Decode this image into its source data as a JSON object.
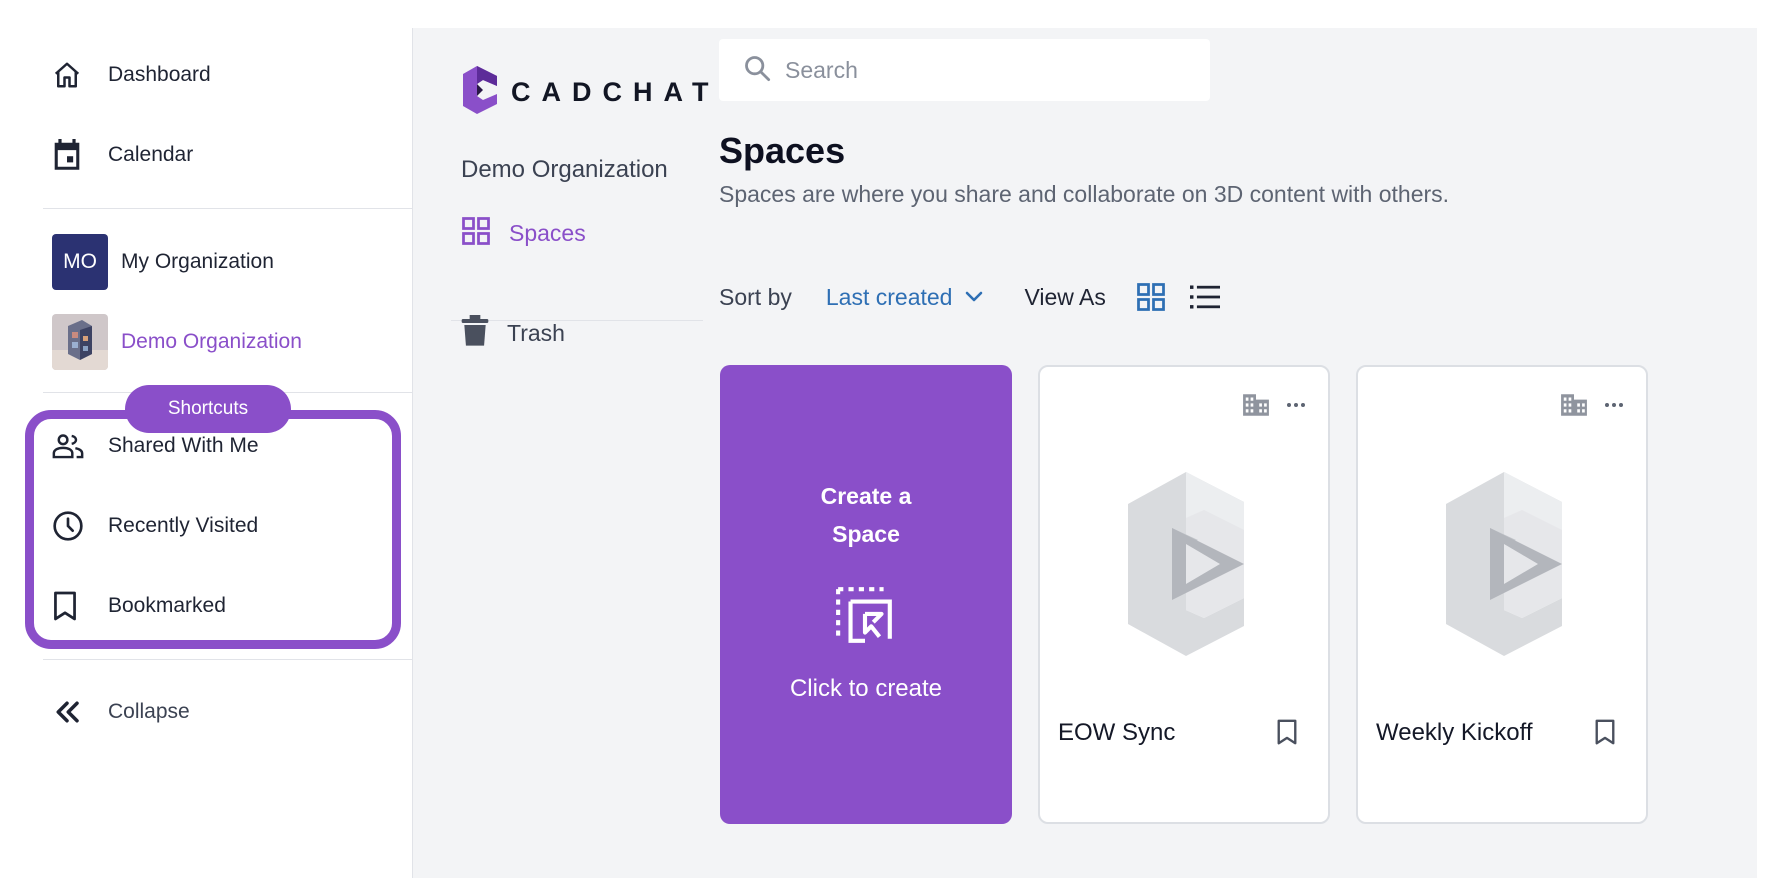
{
  "sidebar": {
    "dashboard": "Dashboard",
    "calendar": "Calendar",
    "orgs": [
      {
        "initials": "MO",
        "label": "My Organization"
      },
      {
        "label": "Demo Organization"
      }
    ],
    "shortcuts_label": "Shortcuts",
    "shortcuts": [
      "Shared With Me",
      "Recently Visited",
      "Bookmarked"
    ],
    "collapse": "Collapse"
  },
  "logo": {
    "text": "CADCHAT"
  },
  "subnav": {
    "org_title": "Demo Organization",
    "spaces": "Spaces",
    "trash": "Trash"
  },
  "search": {
    "placeholder": "Search"
  },
  "page": {
    "title": "Spaces",
    "subtitle": "Spaces are where you share and collaborate on 3D content with others."
  },
  "toolbar": {
    "sort_by": "Sort by",
    "sort_value": "Last created",
    "view_as": "View As"
  },
  "create_card": {
    "title_line1": "Create a",
    "title_line2": "Space",
    "subtitle": "Click to create"
  },
  "spaces": [
    {
      "name": "EOW Sync"
    },
    {
      "name": "Weekly Kickoff"
    }
  ],
  "colors": {
    "accent": "#8a4fc9",
    "link": "#2e6fb4",
    "avatar": "#2b3272",
    "background": "#f3f4f6"
  }
}
